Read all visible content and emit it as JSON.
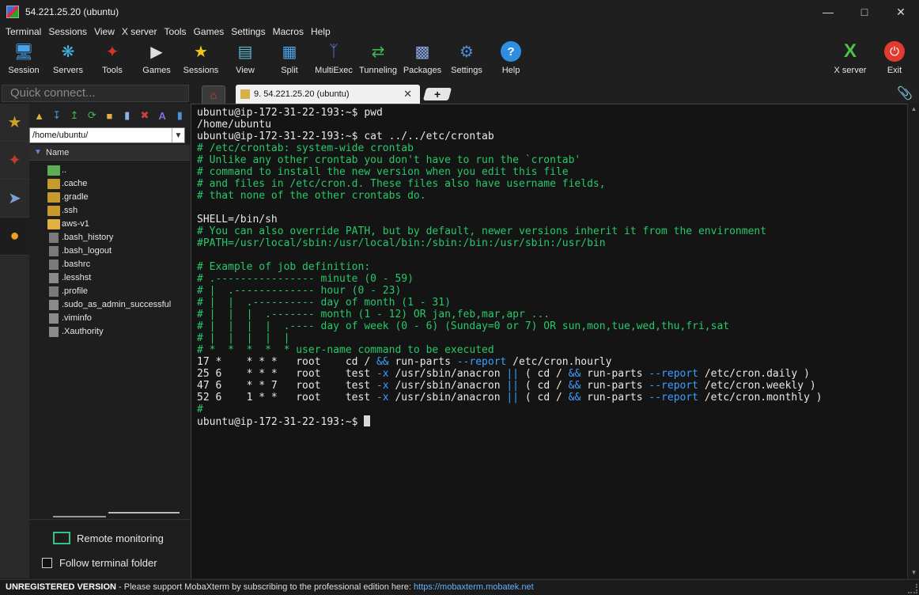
{
  "window": {
    "title": "54.221.25.20 (ubuntu)"
  },
  "menu": [
    "Terminal",
    "Sessions",
    "View",
    "X server",
    "Tools",
    "Games",
    "Settings",
    "Macros",
    "Help"
  ],
  "toolbar": {
    "items": [
      "Session",
      "Servers",
      "Tools",
      "Games",
      "Sessions",
      "View",
      "Split",
      "MultiExec",
      "Tunneling",
      "Packages",
      "Settings",
      "Help"
    ],
    "right_items": [
      "X server",
      "Exit"
    ]
  },
  "quick_connect": {
    "placeholder": "Quick connect..."
  },
  "tabs": {
    "session_label": "9. 54.221.25.20 (ubuntu)"
  },
  "file_panel": {
    "path": "/home/ubuntu/",
    "column_header": "Name",
    "files": [
      "..",
      ".cache",
      ".gradle",
      ".ssh",
      "aws-v1",
      ".bash_history",
      ".bash_logout",
      ".bashrc",
      ".lesshst",
      ".profile",
      ".sudo_as_admin_successful",
      ".viminfo",
      ".Xauthority"
    ],
    "remote_monitoring": "Remote monitoring",
    "follow_terminal": "Follow terminal folder"
  },
  "terminal": {
    "lines": [
      [
        {
          "t": "ubuntu@ip-172-31-22-193:~$ pwd",
          "c": ""
        }
      ],
      [
        {
          "t": "/home/ubuntu",
          "c": ""
        }
      ],
      [
        {
          "t": "ubuntu@ip-172-31-22-193:~$ cat ../../etc/crontab",
          "c": ""
        }
      ],
      [
        {
          "t": "# /etc/crontab: system-wide crontab",
          "c": "com"
        }
      ],
      [
        {
          "t": "# Unlike any other crontab you don't have to run the `crontab'",
          "c": "com"
        }
      ],
      [
        {
          "t": "# command to install the new version when you edit this file",
          "c": "com"
        }
      ],
      [
        {
          "t": "# and files in /etc/cron.d. These files also have username fields,",
          "c": "com"
        }
      ],
      [
        {
          "t": "# that none of the other crontabs do.",
          "c": "com"
        }
      ],
      [
        {
          "t": "",
          "c": ""
        }
      ],
      [
        {
          "t": "SHELL=/bin/sh",
          "c": ""
        }
      ],
      [
        {
          "t": "# You can also override PATH, but by default, newer versions inherit it from the environment",
          "c": "com"
        }
      ],
      [
        {
          "t": "#PATH=/usr/local/sbin:/usr/local/bin:/sbin:/bin:/usr/sbin:/usr/bin",
          "c": "com"
        }
      ],
      [
        {
          "t": "",
          "c": ""
        }
      ],
      [
        {
          "t": "# Example of job definition:",
          "c": "com"
        }
      ],
      [
        {
          "t": "# .---------------- minute (0 - 59)",
          "c": "com"
        }
      ],
      [
        {
          "t": "# |  .------------- hour (0 - 23)",
          "c": "com"
        }
      ],
      [
        {
          "t": "# |  |  .---------- day of month (1 - 31)",
          "c": "com"
        }
      ],
      [
        {
          "t": "# |  |  |  .------- month (1 - 12) OR jan,feb,mar,apr ...",
          "c": "com"
        }
      ],
      [
        {
          "t": "# |  |  |  |  .---- day of week (0 - 6) (Sunday=0 or 7) OR sun,mon,tue,wed,thu,fri,sat",
          "c": "com"
        }
      ],
      [
        {
          "t": "# |  |  |  |  |",
          "c": "com"
        }
      ],
      [
        {
          "t": "# *  *  *  *  * user-name command to be executed",
          "c": "com"
        }
      ],
      [
        {
          "t": "17 *    * * *   root    cd / ",
          "c": ""
        },
        {
          "t": "&&",
          "c": "op"
        },
        {
          "t": " run-parts ",
          "c": ""
        },
        {
          "t": "--report",
          "c": "op"
        },
        {
          "t": " /etc/cron.hourly",
          "c": ""
        }
      ],
      [
        {
          "t": "25 6    * * *   root    test ",
          "c": ""
        },
        {
          "t": "-x",
          "c": "op"
        },
        {
          "t": " /usr/sbin/anacron ",
          "c": ""
        },
        {
          "t": "||",
          "c": "op"
        },
        {
          "t": " ( cd / ",
          "c": ""
        },
        {
          "t": "&&",
          "c": "op"
        },
        {
          "t": " run-parts ",
          "c": ""
        },
        {
          "t": "--report",
          "c": "op"
        },
        {
          "t": " /etc/cron.daily )",
          "c": ""
        }
      ],
      [
        {
          "t": "47 6    * * 7   root    test ",
          "c": ""
        },
        {
          "t": "-x",
          "c": "op"
        },
        {
          "t": " /usr/sbin/anacron ",
          "c": ""
        },
        {
          "t": "||",
          "c": "op"
        },
        {
          "t": " ( cd / ",
          "c": ""
        },
        {
          "t": "&&",
          "c": "op"
        },
        {
          "t": " run-parts ",
          "c": ""
        },
        {
          "t": "--report",
          "c": "op"
        },
        {
          "t": " /etc/cron.weekly )",
          "c": ""
        }
      ],
      [
        {
          "t": "52 6    1 * *   root    test ",
          "c": ""
        },
        {
          "t": "-x",
          "c": "op"
        },
        {
          "t": " /usr/sbin/anacron ",
          "c": ""
        },
        {
          "t": "||",
          "c": "op"
        },
        {
          "t": " ( cd / ",
          "c": ""
        },
        {
          "t": "&&",
          "c": "op"
        },
        {
          "t": " run-parts ",
          "c": ""
        },
        {
          "t": "--report",
          "c": "op"
        },
        {
          "t": " /etc/cron.monthly )",
          "c": ""
        }
      ],
      [
        {
          "t": "#",
          "c": "com"
        }
      ],
      [
        {
          "t": "ubuntu@ip-172-31-22-193:~$ ",
          "c": ""
        }
      ]
    ]
  },
  "status": {
    "label": "UNREGISTERED VERSION",
    "message": " -  Please support MobaXterm by subscribing to the professional edition here: ",
    "link": "https://mobaxterm.mobatek.net"
  },
  "colors": {
    "comment": "#27c86a",
    "operator": "#3aa0ff",
    "background": "#141414"
  }
}
